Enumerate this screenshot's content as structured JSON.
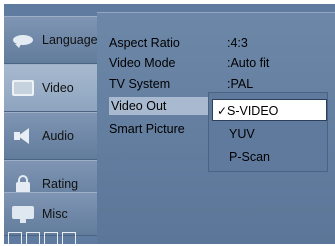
{
  "nav": {
    "items": [
      {
        "label": "Language",
        "icon": "speech-bubble-icon"
      },
      {
        "label": "Video",
        "icon": "tv-icon"
      },
      {
        "label": "Audio",
        "icon": "speaker-icon"
      },
      {
        "label": "Rating",
        "icon": "lock-icon"
      },
      {
        "label": "Misc",
        "icon": "monitor-icon"
      }
    ],
    "active": "Video"
  },
  "settings": [
    {
      "label": "Aspect Ratio",
      "value": ":4:3"
    },
    {
      "label": "Video Mode",
      "value": ":Auto fit"
    },
    {
      "label": "TV System",
      "value": ":PAL"
    },
    {
      "label": "Video Out",
      "value": ""
    },
    {
      "label": "Smart Picture",
      "value": ""
    }
  ],
  "selected_setting": "Video Out",
  "dropdown": {
    "check_mark": "✓",
    "options": [
      "S-VIDEO",
      "YUV",
      "P-Scan"
    ],
    "selected": "S-VIDEO"
  },
  "page_indicators": 4,
  "colors": {
    "frame": "#5f7b9f",
    "panel": "#6d87a8",
    "active_nav": "#a7b9cf",
    "dropdown_selected_bg": "#ffffff"
  }
}
